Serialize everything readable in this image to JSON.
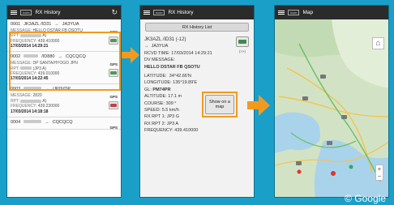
{
  "phone1": {
    "title": "RX History",
    "logo": "icom",
    "items": [
      {
        "num": "0001",
        "route": "JK3AZL /ID31",
        "arrow": "→",
        "dest": "JA3YUA",
        "message_label": "MESSAGE:",
        "message": "HELLO DSTAR FB QSOTU",
        "rpt_label": "RPT:",
        "rpt_suffix": "A)",
        "freq_label": "FREQUENCY:",
        "freq": "439.410000",
        "date": "17/03/2014 14:29:21",
        "gps": "GPS"
      },
      {
        "num": "0002",
        "route": "/ID880",
        "arrow": "→",
        "dest": "CQCQCQ",
        "message_label": "MESSAGE:",
        "message": "DP SANTA/HYOGO JPN",
        "rpt_label": "RPT:",
        "rpt_suffix": "(JP3  A)",
        "freq_label": "FREQUENCY:",
        "freq": "439.010000",
        "date": "17/03/2014 14:22:45",
        "gps": "GPS"
      },
      {
        "num": "0003",
        "route": "",
        "arrow": "→",
        "dest": "/JP0VDP",
        "message_label": "MESSAGE:",
        "message": "2820",
        "rpt_label": "RPT:",
        "rpt_suffix": "A)",
        "freq_label": "FREQUENCY:",
        "freq": "439.230000",
        "date": "17/03/2014 14:18:18",
        "gps": "GPS"
      },
      {
        "num": "0004",
        "route": "",
        "arrow": "→",
        "dest": "CQCQCQ",
        "gps": "GPS"
      }
    ]
  },
  "phone2": {
    "title": "RX History",
    "logo": "icom",
    "list_button": "RX History List",
    "callsign": "JK3AZL /ID31  (-12)",
    "arrow": "→",
    "dest": "JA3YUA",
    "rcvd_label": "RCVD TIME:",
    "rcvd": "17/03/2014 14:29:21",
    "dv_label": "DV MESSAGE:",
    "dv_message": "HELLO DSTAR FB QSOTU",
    "lat_label": "LATITUDE:",
    "lat": "34°42.66'N",
    "lon_label": "LONGITUDE:",
    "lon": "135°19.89'E",
    "gl_label": "GL:",
    "gl": "PM74PR",
    "alt_label": "ALTITUDE:",
    "alt": "17.1 m",
    "course_label": "COURSE:",
    "course": "309 °",
    "speed_label": "SPEED:",
    "speed": "5.5 km/h",
    "rpt1_label": "RX RPT 1:",
    "rpt1": "JP3 G",
    "rpt2_label": "RX RPT 2:",
    "rpt2": "JP3 A",
    "freq_label": "FREQUENCY:",
    "freq": "439.410000",
    "car_label": "(>>)",
    "show_map": "Show on a map"
  },
  "phone3": {
    "title": "Map",
    "logo": "icom",
    "home_icon": "home-icon",
    "zoom_in": "+",
    "zoom_out": "−"
  },
  "credit": "© Google",
  "colors": {
    "background": "#1aa0c8",
    "highlight": "#f39a1e",
    "topbar": "#2b2b2b"
  }
}
